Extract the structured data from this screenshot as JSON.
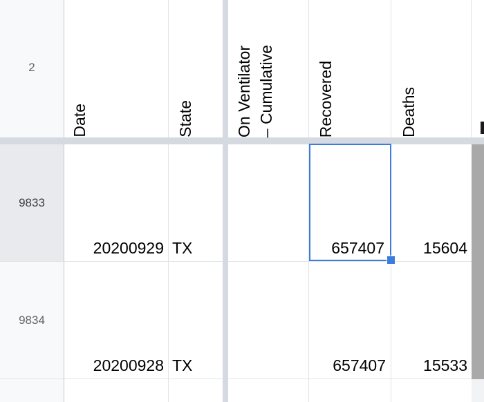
{
  "header_row": {
    "row_number": "2",
    "columns": [
      {
        "key": "date",
        "label": "Date"
      },
      {
        "key": "state",
        "label": "State"
      },
      {
        "key": "vent_cum_1",
        "label": "On Ventilator"
      },
      {
        "key": "vent_cum_2",
        "label": "– Cumulative"
      },
      {
        "key": "recovered",
        "label": "Recovered"
      },
      {
        "key": "deaths",
        "label": "Deaths"
      }
    ]
  },
  "rows": [
    {
      "row_number": "9833",
      "date": "20200929",
      "state": "TX",
      "ventilator": "",
      "recovered": "657407",
      "deaths": "15604"
    },
    {
      "row_number": "9834",
      "date": "20200928",
      "state": "TX",
      "ventilator": "",
      "recovered": "657407",
      "deaths": "15533"
    }
  ],
  "selection": {
    "row": "9833",
    "column": "Recovered"
  },
  "colors": {
    "selection": "#3b7ddd",
    "freeze_bar": "#d5d9e0",
    "gridline": "#e2e3e3",
    "row_header_bg": "#f8f9fa"
  }
}
